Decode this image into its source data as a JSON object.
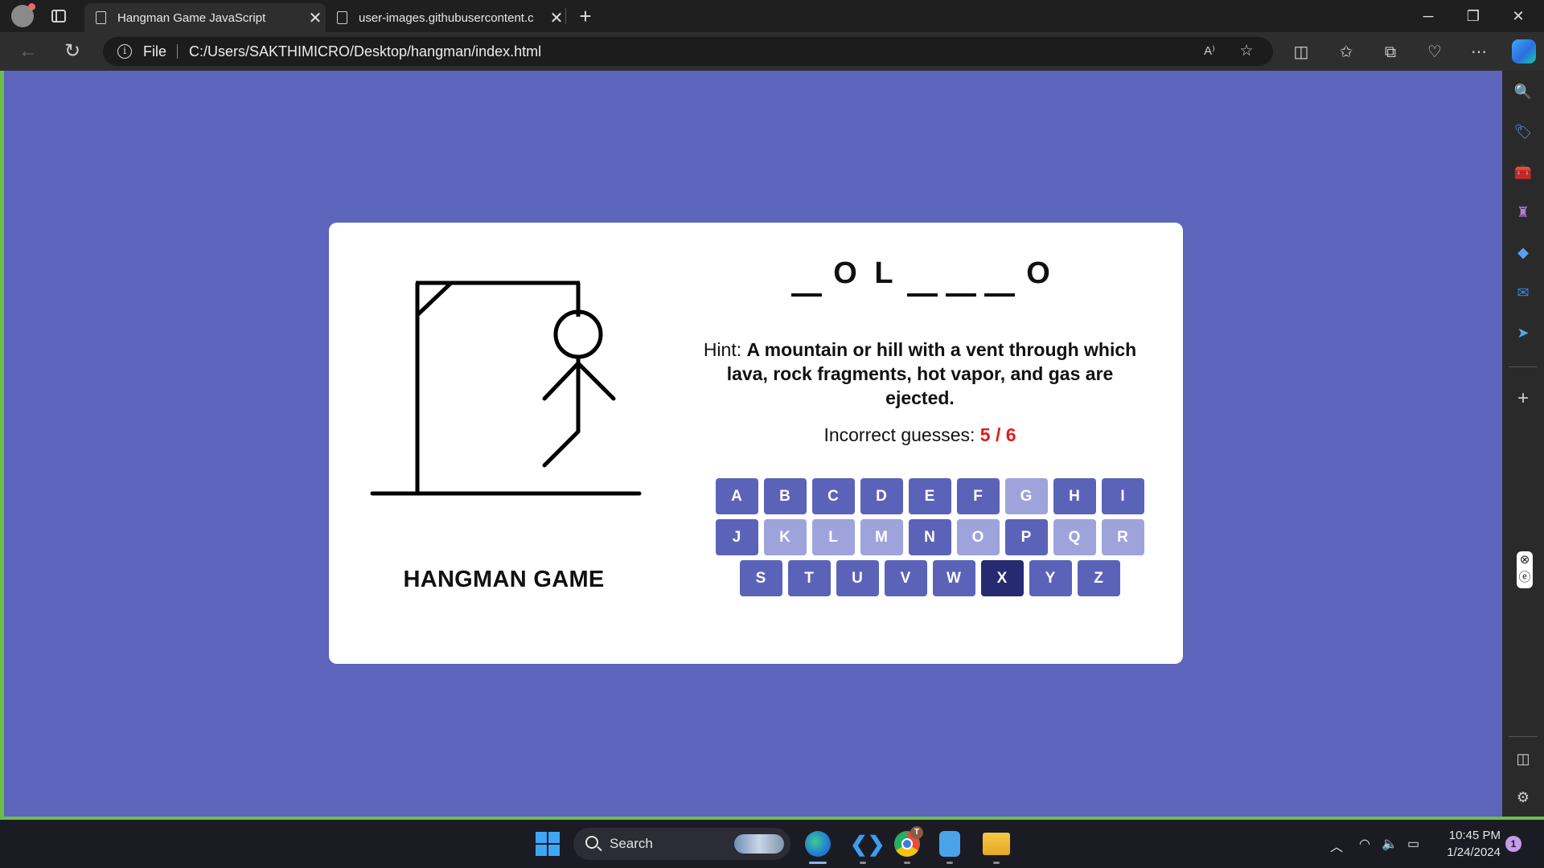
{
  "browser": {
    "tabs": [
      {
        "title": "Hangman Game JavaScript",
        "active": true
      },
      {
        "title": "user-images.githubusercontent.c",
        "active": false
      }
    ],
    "address": {
      "scheme_label": "File",
      "url": "C:/Users/SAKTHIMICRO/Desktop/hangman/index.html"
    },
    "colors": {
      "frame": "#1f1f1f",
      "toolbar": "#2e2e2e",
      "page_border": "#6abf4b"
    }
  },
  "game": {
    "title": "HANGMAN GAME",
    "word_display": [
      "",
      "O",
      "L",
      "",
      "",
      "",
      "O"
    ],
    "hint_label": "Hint:",
    "hint_text": "A mountain or hill with a vent through which lava, rock fragments, hot vapor, and gas are ejected.",
    "incorrect_label": "Incorrect guesses:",
    "incorrect_count": "5 / 6",
    "wrong_guesses": 5,
    "max_guesses": 6,
    "keyboard": [
      [
        {
          "k": "A",
          "s": "normal"
        },
        {
          "k": "B",
          "s": "normal"
        },
        {
          "k": "C",
          "s": "normal"
        },
        {
          "k": "D",
          "s": "normal"
        },
        {
          "k": "E",
          "s": "normal"
        },
        {
          "k": "F",
          "s": "normal"
        },
        {
          "k": "G",
          "s": "used"
        },
        {
          "k": "H",
          "s": "normal"
        },
        {
          "k": "I",
          "s": "normal"
        }
      ],
      [
        {
          "k": "J",
          "s": "normal"
        },
        {
          "k": "K",
          "s": "used"
        },
        {
          "k": "L",
          "s": "used"
        },
        {
          "k": "M",
          "s": "used"
        },
        {
          "k": "N",
          "s": "normal"
        },
        {
          "k": "O",
          "s": "used"
        },
        {
          "k": "P",
          "s": "normal"
        },
        {
          "k": "Q",
          "s": "used"
        },
        {
          "k": "R",
          "s": "used"
        }
      ],
      [
        {
          "k": "S",
          "s": "normal"
        },
        {
          "k": "T",
          "s": "normal"
        },
        {
          "k": "U",
          "s": "normal"
        },
        {
          "k": "V",
          "s": "normal"
        },
        {
          "k": "W",
          "s": "normal"
        },
        {
          "k": "X",
          "s": "pressed"
        },
        {
          "k": "Y",
          "s": "normal"
        },
        {
          "k": "Z",
          "s": "normal"
        }
      ]
    ],
    "colors": {
      "background": "#5d64bb",
      "key": "#5b63b8",
      "key_used": "#9fa3dc",
      "key_pressed": "#262a70",
      "error_count": "#e11d1d"
    }
  },
  "taskbar": {
    "search_placeholder": "Search",
    "time": "10:45 PM",
    "date": "1/24/2024",
    "notification_count": "1",
    "chrome_badge": "T"
  }
}
